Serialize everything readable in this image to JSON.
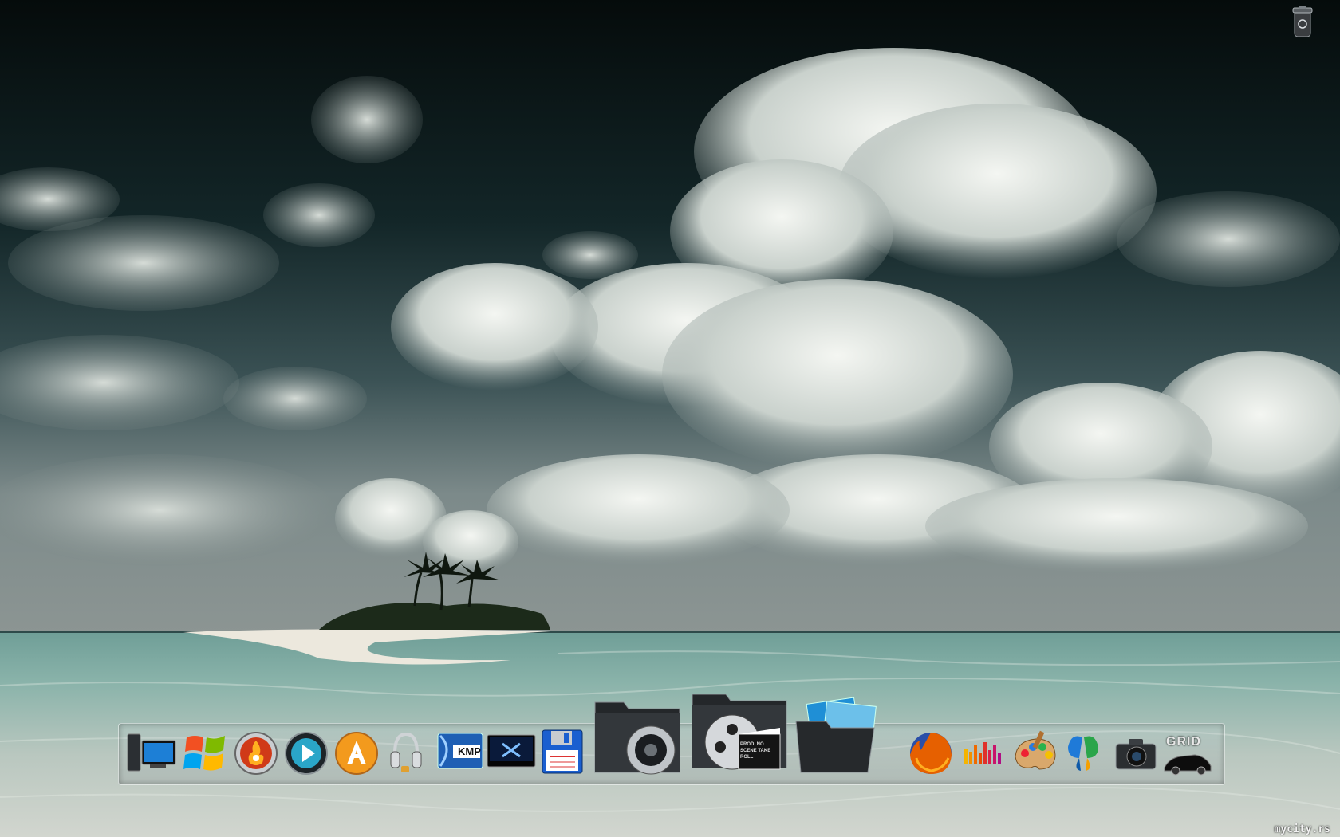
{
  "desktop": {
    "watermark": "mycity.rs"
  },
  "trash": {
    "icon": "recycle-bin-icon"
  },
  "dock": {
    "items": [
      {
        "name": "my-computer",
        "icon": "computer-icon"
      },
      {
        "name": "windows-start",
        "icon": "windows-logo-icon"
      },
      {
        "name": "burning-app",
        "icon": "flame-disc-icon"
      },
      {
        "name": "media-player",
        "icon": "play-button-icon"
      },
      {
        "name": "aimp-player",
        "icon": "aimp-a-icon"
      },
      {
        "name": "audio-headphones",
        "icon": "headphones-icon"
      },
      {
        "name": "kmplayer",
        "icon": "kmp-icon",
        "label": "KMP"
      },
      {
        "name": "media-center",
        "icon": "tv-screen-icon"
      },
      {
        "name": "floppy-save",
        "icon": "floppy-disk-icon"
      },
      {
        "name": "music-folder",
        "icon": "speaker-folder-icon"
      },
      {
        "name": "video-folder",
        "icon": "film-folder-icon",
        "clapper_label": "PROD. NO. SCENE TAKE ROLL"
      },
      {
        "name": "pictures-folder",
        "icon": "photos-folder-icon"
      },
      {
        "name": "firefox",
        "icon": "firefox-icon"
      },
      {
        "name": "audio-equalizer",
        "icon": "equalizer-icon"
      },
      {
        "name": "paint-app",
        "icon": "paint-palette-icon"
      },
      {
        "name": "messenger",
        "icon": "butterfly-icon"
      },
      {
        "name": "camera-app",
        "icon": "camera-icon"
      },
      {
        "name": "race-driver-grid",
        "icon": "grid-car-icon",
        "label": "GRID"
      }
    ]
  },
  "colors": {
    "sky_dark": "#07100f",
    "sky_mid": "#1e3a3e",
    "cloud": "#e8ece8",
    "sea": "#7fb0a6",
    "sand": "#e9e6dc",
    "firefox_orange": "#e66000",
    "aimp_orange": "#f39a1d"
  }
}
